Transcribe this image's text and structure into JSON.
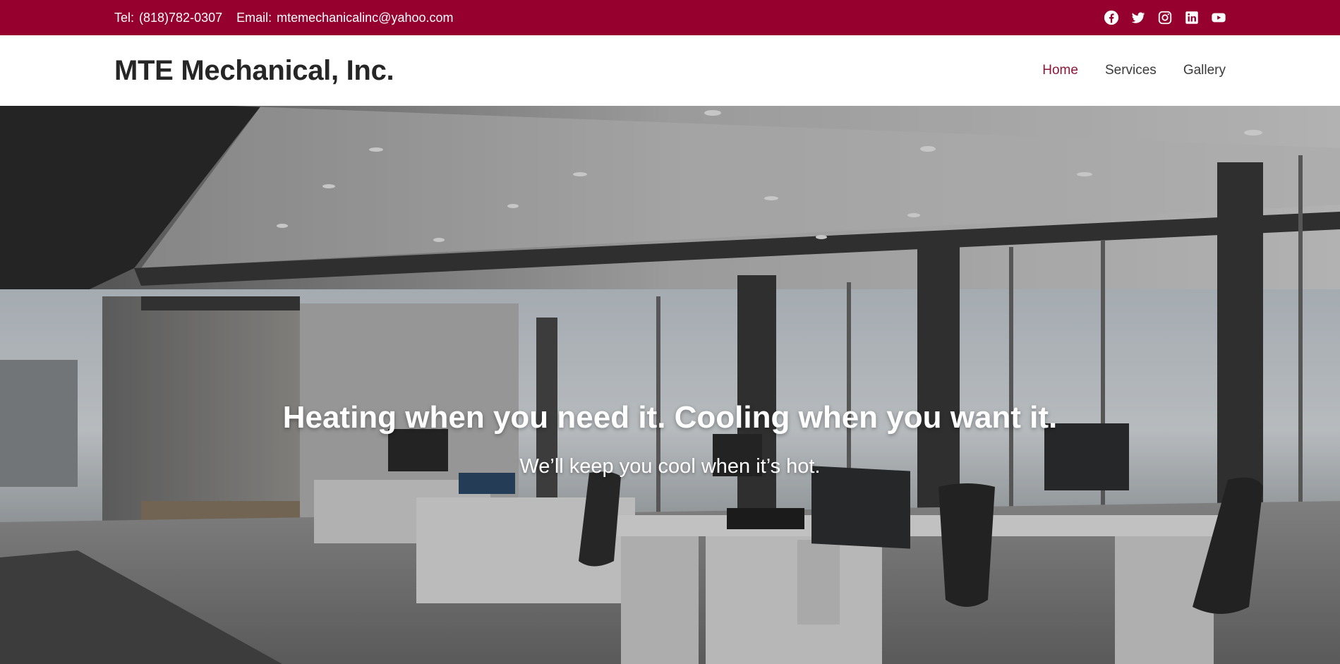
{
  "topbar": {
    "tel_label": "Tel:",
    "tel_value": "(818)782-0307",
    "email_label": "Email:",
    "email_value": "mtemechanicalinc@yahoo.com",
    "social_icons": [
      "facebook-icon",
      "twitter-icon",
      "instagram-icon",
      "linkedin-icon",
      "youtube-icon"
    ]
  },
  "header": {
    "logo": "MTE Mechanical, Inc.",
    "nav": [
      {
        "label": "Home",
        "active": true
      },
      {
        "label": "Services",
        "active": false
      },
      {
        "label": "Gallery",
        "active": false
      }
    ]
  },
  "hero": {
    "title": "Heating when you need it. Cooling when you want it.",
    "subtitle": "We’ll keep you cool when it’s hot."
  },
  "colors": {
    "topbar_bg": "#96002f",
    "nav_active": "#8c1538",
    "text_dark": "#262626"
  }
}
